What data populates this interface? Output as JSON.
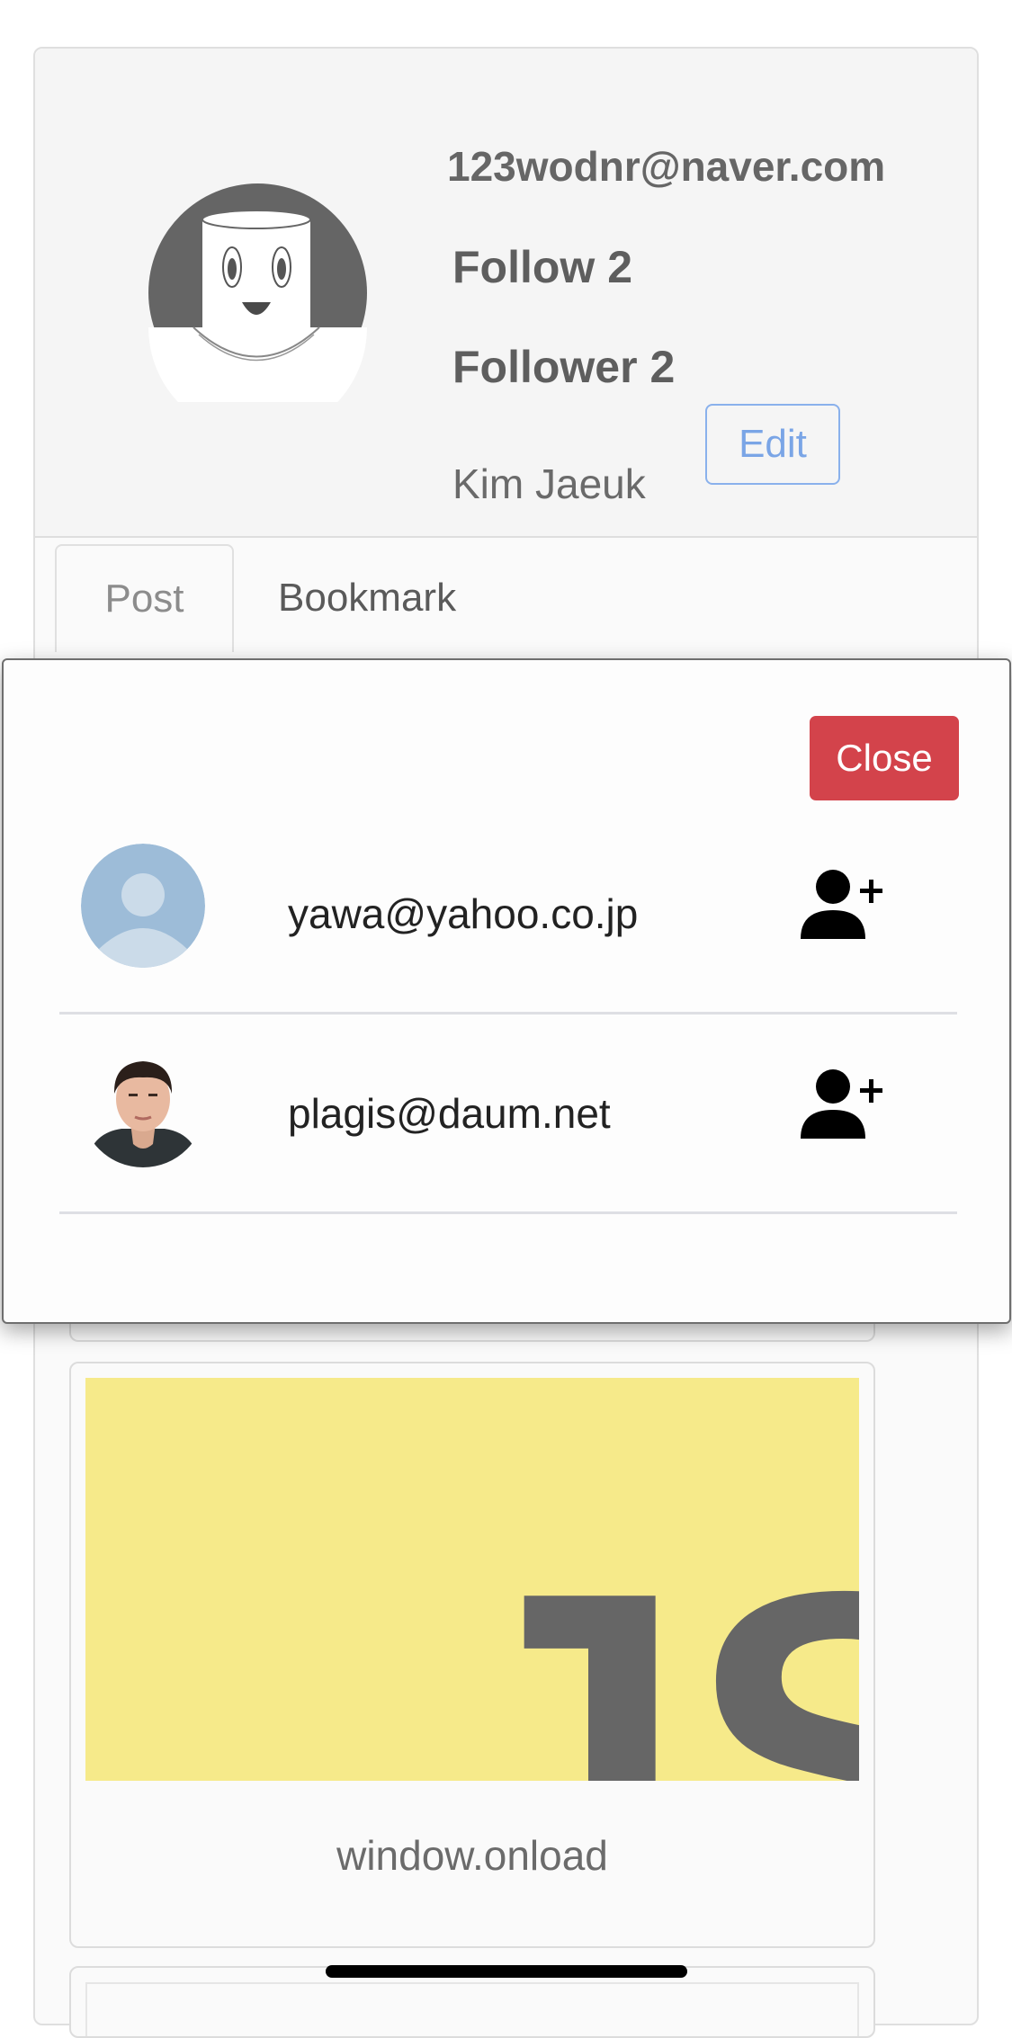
{
  "profile": {
    "email": "123wodnr@naver.com",
    "follow_label": "Follow 2",
    "follower_label": "Follower 2",
    "name": "Kim Jaeuk",
    "edit_label": "Edit"
  },
  "tabs": [
    {
      "label": "Post"
    },
    {
      "label": "Bookmark"
    }
  ],
  "posts": [
    {
      "title": "window.onload",
      "image_text": "JS"
    }
  ],
  "modal": {
    "close_label": "Close",
    "users": [
      {
        "email": "yawa@yahoo.co.jp",
        "avatar": "default-avatar-icon"
      },
      {
        "email": "plagis@daum.net",
        "avatar": "man-portrait"
      }
    ]
  },
  "colors": {
    "close": "#d3434b",
    "edit": "#7aa5e6",
    "post_image_bg": "#f6ea8a"
  }
}
